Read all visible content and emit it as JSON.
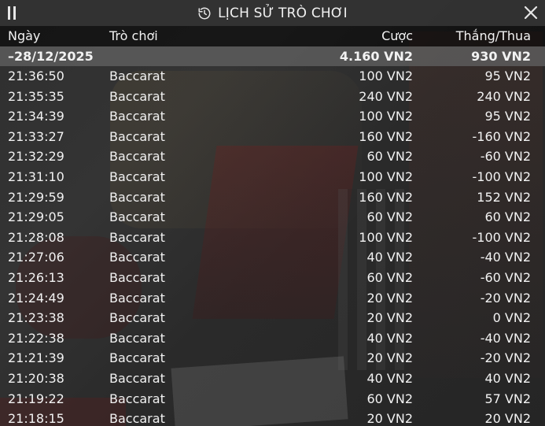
{
  "header": {
    "title": "LỊCH SỬ TRÒ CHƠI"
  },
  "columns": {
    "date": "Ngày",
    "game": "Trò chơi",
    "bet": "Cược",
    "win_loss": "Thắng/Thua"
  },
  "date_group": {
    "date": "–28/12/2025",
    "bet_total": "4.160 VN2",
    "win_total": "930 VN2"
  },
  "rows": [
    {
      "time": "21:36:50",
      "game": "Baccarat",
      "bet": "100 VN2",
      "win": "95 VN2"
    },
    {
      "time": "21:35:35",
      "game": "Baccarat",
      "bet": "240 VN2",
      "win": "240 VN2"
    },
    {
      "time": "21:34:39",
      "game": "Baccarat",
      "bet": "100 VN2",
      "win": "95 VN2"
    },
    {
      "time": "21:33:27",
      "game": "Baccarat",
      "bet": "160 VN2",
      "win": "-160 VN2"
    },
    {
      "time": "21:32:29",
      "game": "Baccarat",
      "bet": "60 VN2",
      "win": "-60 VN2"
    },
    {
      "time": "21:31:10",
      "game": "Baccarat",
      "bet": "100 VN2",
      "win": "-100 VN2"
    },
    {
      "time": "21:29:59",
      "game": "Baccarat",
      "bet": "160 VN2",
      "win": "152 VN2"
    },
    {
      "time": "21:29:05",
      "game": "Baccarat",
      "bet": "60 VN2",
      "win": "60 VN2"
    },
    {
      "time": "21:28:08",
      "game": "Baccarat",
      "bet": "100 VN2",
      "win": "-100 VN2"
    },
    {
      "time": "21:27:06",
      "game": "Baccarat",
      "bet": "40 VN2",
      "win": "-40 VN2"
    },
    {
      "time": "21:26:13",
      "game": "Baccarat",
      "bet": "60 VN2",
      "win": "-60 VN2"
    },
    {
      "time": "21:24:49",
      "game": "Baccarat",
      "bet": "20 VN2",
      "win": "-20 VN2"
    },
    {
      "time": "21:23:38",
      "game": "Baccarat",
      "bet": "20 VN2",
      "win": "0 VN2"
    },
    {
      "time": "21:22:38",
      "game": "Baccarat",
      "bet": "40 VN2",
      "win": "-40 VN2"
    },
    {
      "time": "21:21:39",
      "game": "Baccarat",
      "bet": "20 VN2",
      "win": "-20 VN2"
    },
    {
      "time": "21:20:38",
      "game": "Baccarat",
      "bet": "40 VN2",
      "win": "40 VN2"
    },
    {
      "time": "21:19:22",
      "game": "Baccarat",
      "bet": "60 VN2",
      "win": "57 VN2"
    },
    {
      "time": "21:18:15",
      "game": "Baccarat",
      "bet": "20 VN2",
      "win": "20 VN2"
    }
  ],
  "icons": {
    "menu": "menu-icon",
    "history": "history-icon",
    "close": "close-icon"
  }
}
